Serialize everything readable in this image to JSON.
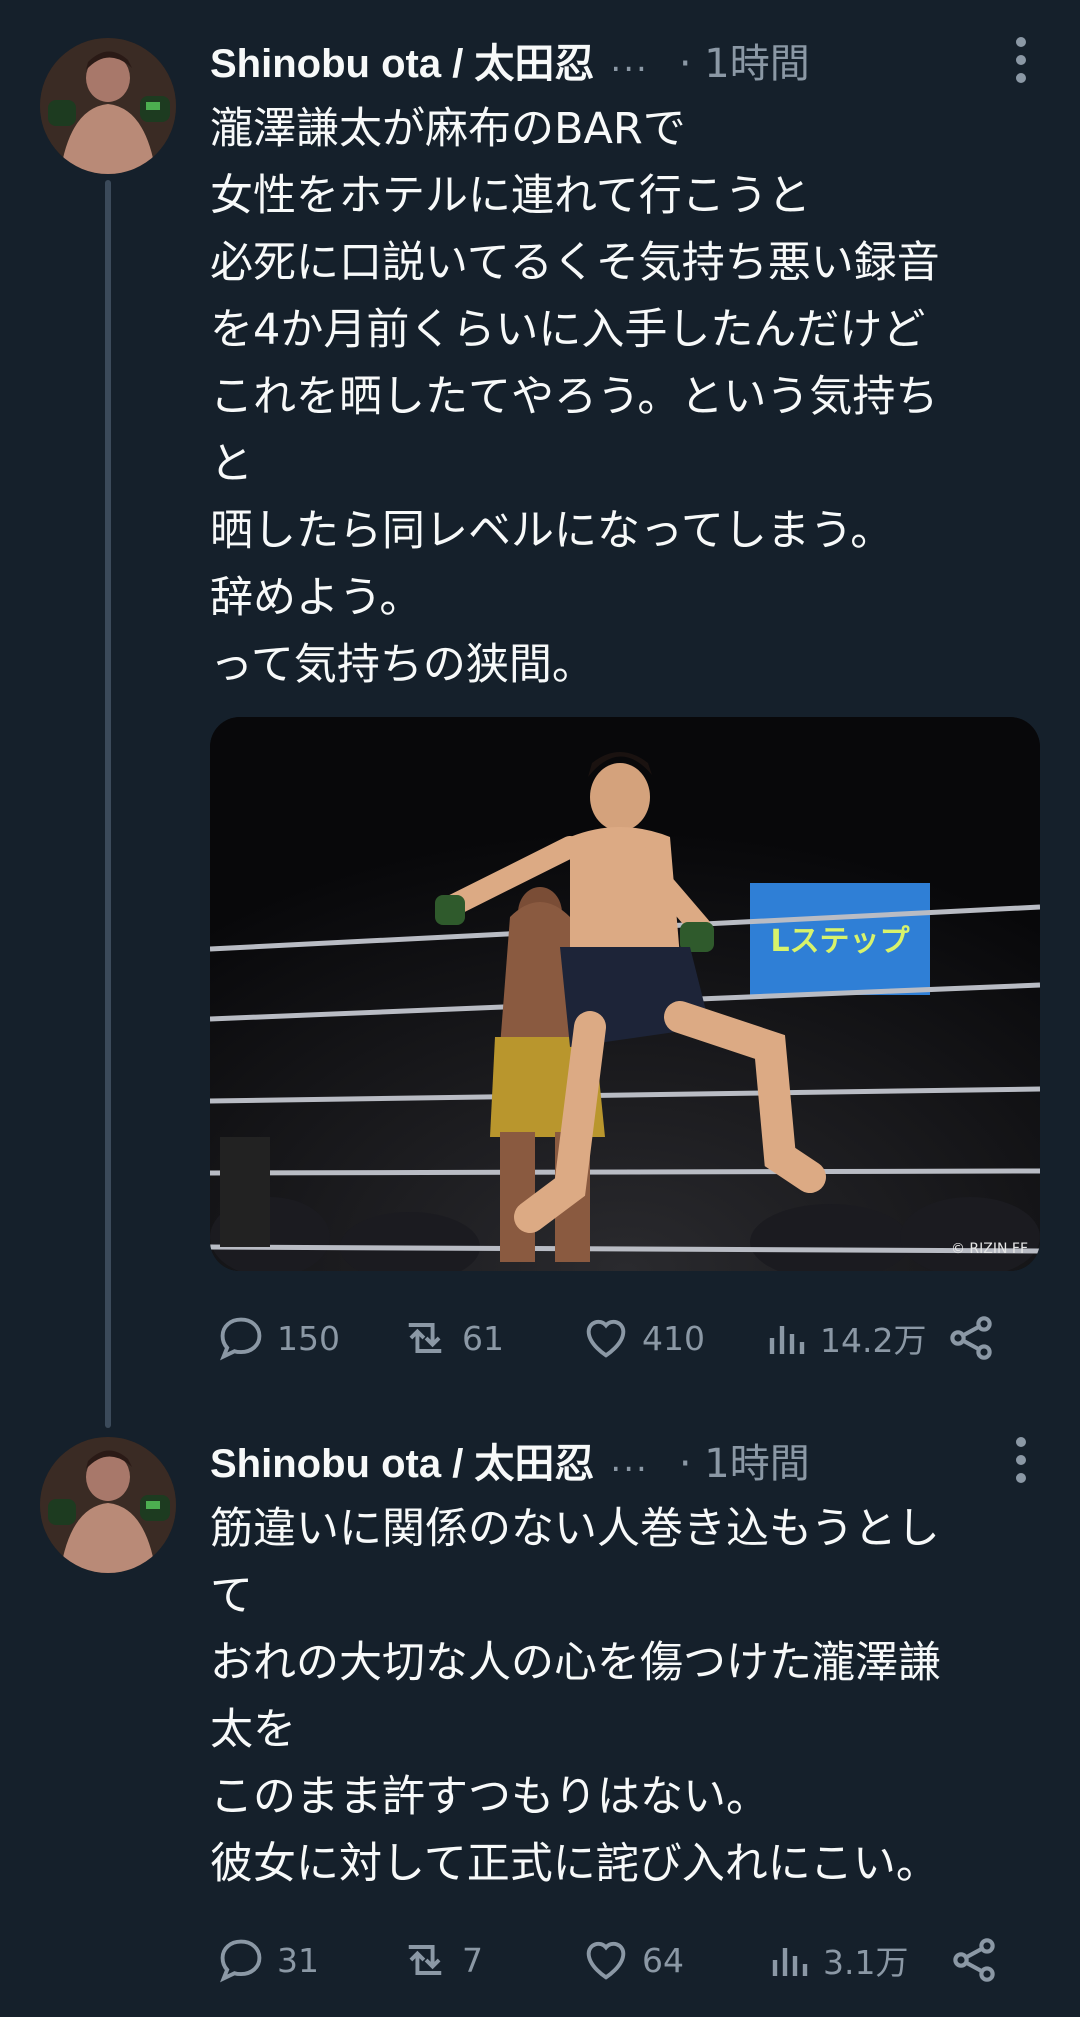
{
  "tweets": [
    {
      "author": "Shinobu ota / 太田忍",
      "ellipsis": "...",
      "time": "· 1時間",
      "lines": [
        "瀧澤謙太が麻布のBARで",
        "女性をホテルに連れて行こうと",
        "必死に口説いてるくそ気持ち悪い録音",
        "を4か月前くらいに入手したんだけど",
        "これを晒したてやろう。という気持ち",
        "と",
        "晒したら同レベルになってしまう。",
        "辞めよう。",
        "って気持ちの狭間。"
      ],
      "media": {
        "watermark": "© RIZIN FF",
        "banner_text": "Lステップ"
      },
      "stats": {
        "replies": "150",
        "retweets": "61",
        "likes": "410",
        "views": "14.2万"
      }
    },
    {
      "author": "Shinobu ota / 太田忍",
      "ellipsis": "...",
      "time": "· 1時間",
      "lines": [
        "筋違いに関係のない人巻き込もうとし",
        "て",
        "おれの大切な人の心を傷つけた瀧澤謙",
        "太を",
        "このまま許すつもりはない。",
        "彼女に対して正式に詫び入れにこい。"
      ],
      "stats": {
        "replies": "31",
        "retweets": "7",
        "likes": "64",
        "views": "3.1万"
      }
    }
  ],
  "colors": {
    "background": "#15202b",
    "text": "#f7f9f9",
    "muted": "#8b98a5",
    "thread_line": "#3b4a5a"
  }
}
